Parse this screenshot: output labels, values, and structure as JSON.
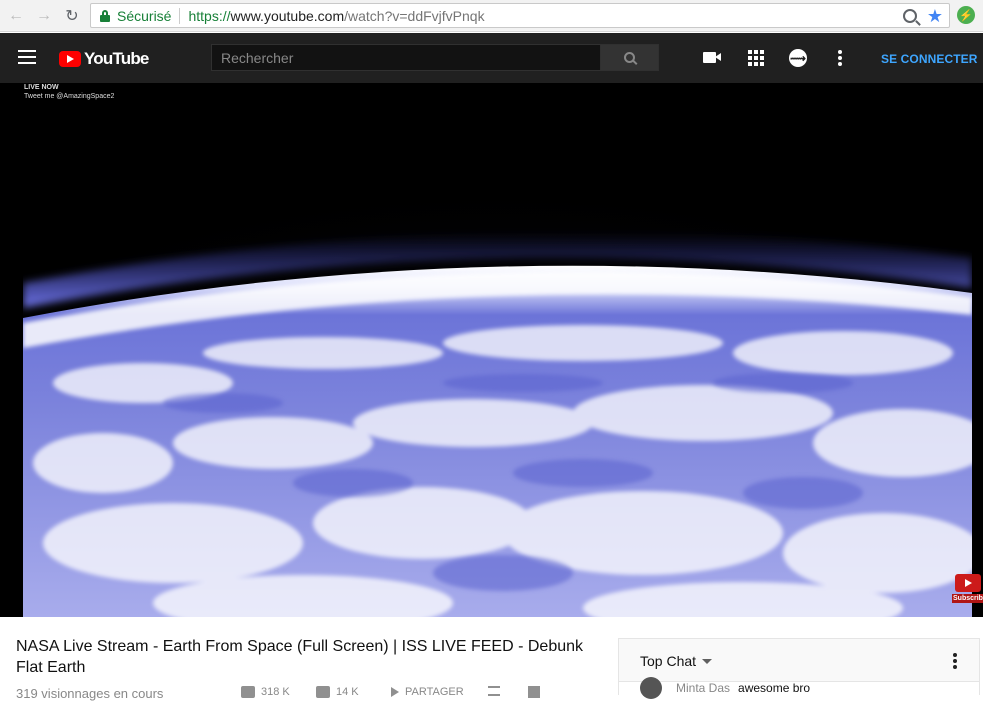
{
  "browser": {
    "back_icon": "back-arrow-icon",
    "forward_icon": "forward-arrow-icon",
    "reload_icon": "reload-icon",
    "secure_label": "Sécurisé",
    "url_scheme": "https://",
    "url_host": "www.youtube.com",
    "url_path": "/watch?v=ddFvjfvPnqk",
    "extension_label": "⚡"
  },
  "header": {
    "logo_text": "YouTube",
    "search_placeholder": "Rechercher",
    "signin_label": "SE CONNECTER"
  },
  "video": {
    "live_label": "LIVE NOW",
    "tweet_label": "Tweet me @AmazingSpace2",
    "subscribe_caption": "Subscribe"
  },
  "info": {
    "title": "NASA Live Stream - Earth From Space (Full Screen) | ISS LIVE FEED - Debunk Flat Earth",
    "views": "319 visionnages en cours",
    "likes": "318 K",
    "dislikes": "14 K",
    "share_label": "PARTAGER"
  },
  "chat": {
    "tab_label": "Top Chat",
    "message": {
      "author": "Minta Das",
      "text": "awesome bro"
    }
  },
  "colors": {
    "youtube_red": "#ff0000",
    "header_bg": "#202020",
    "signin_blue": "#3ea6ff",
    "secure_green": "#188038"
  }
}
